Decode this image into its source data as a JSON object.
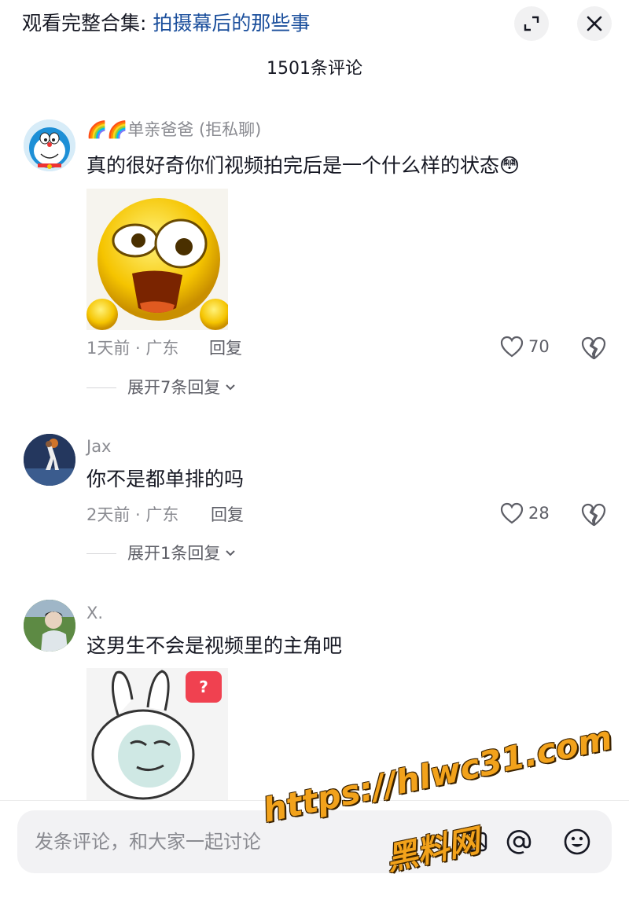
{
  "header": {
    "collection_prefix": "观看完整合集: ",
    "collection_link": "拍摄幕后的那些事",
    "comment_count": "1501条评论"
  },
  "comments": [
    {
      "username": "🌈🌈单亲爸爸 (拒私聊)",
      "text": "真的很好奇你们视频拍完后是一个什么样的状态",
      "emoji": "😳",
      "meta": "1天前 · 广东",
      "reply_label": "回复",
      "likes": "70",
      "expand": "展开7条回复"
    },
    {
      "username": "Jax",
      "text": "你不是都单排的吗",
      "meta": "2天前 · 广东",
      "reply_label": "回复",
      "likes": "28",
      "expand": "展开1条回复"
    },
    {
      "username": "X.",
      "text": "这男生不会是视频里的主角吧",
      "badge": "?"
    }
  ],
  "input": {
    "placeholder": "发条评论，和大家一起讨论"
  },
  "watermark": {
    "url": "https://hlwc31.com",
    "name": "黑料网"
  },
  "colors": {
    "link": "#1b4f9c",
    "muted": "#8a8b91",
    "watermark": "#f2a21b"
  }
}
